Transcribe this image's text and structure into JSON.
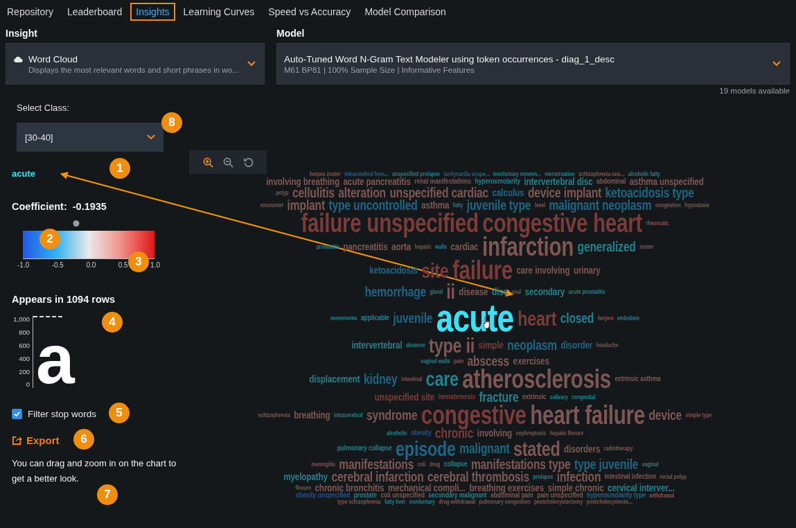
{
  "tabs": [
    {
      "label": "Repository",
      "selected": false
    },
    {
      "label": "Leaderboard",
      "selected": false
    },
    {
      "label": "Insights",
      "selected": true
    },
    {
      "label": "Learning Curves",
      "selected": false
    },
    {
      "label": "Speed vs Accuracy",
      "selected": false
    },
    {
      "label": "Model Comparison",
      "selected": false
    }
  ],
  "insight": {
    "label": "Insight",
    "title": "Word Cloud",
    "description": "Displays the most relevant words and short phrases in wo..."
  },
  "model": {
    "label": "Model",
    "title": "Auto-Tuned Word N-Gram Text Modeler using token occurrences - diag_1_desc",
    "description": "M61 BP81 | 100% Sample Size | Informative Features",
    "count": "19 models available"
  },
  "class_select": {
    "label": "Select Class:",
    "value": "[30-40]"
  },
  "word_detail": {
    "word": "acute",
    "coefficient_label": "Coefficient:",
    "coefficient": "-0.1935",
    "level": 0.403,
    "scale_ticks": [
      "-1.0",
      "-0.5",
      "0.0",
      "0.5",
      "1.0"
    ],
    "appears": "Appears in 1094 rows",
    "axis_ticks": [
      "1,000",
      "800",
      "600",
      "400",
      "200",
      "0"
    ],
    "glyph": "a"
  },
  "filter_stop_words": {
    "label": "Filter stop words",
    "checked": true
  },
  "export": {
    "label": "Export"
  },
  "hint": "You can drag and zoom in on the chart to get a better look.",
  "callouts": [
    "1",
    "2",
    "3",
    "4",
    "5",
    "6",
    "7",
    "8"
  ],
  "word_cloud": {
    "rows": [
      {
        "words": [
          {
            "text": "herpes zoster",
            "kind": "tiny",
            "color": "#7e5754",
            "selected": false
          },
          {
            "text": "intracerebral hem...",
            "kind": "tiny",
            "color": "#1e6585",
            "selected": false
          },
          {
            "text": "unspecified prolapse",
            "kind": "tiny",
            "color": "#24808c",
            "selected": false
          },
          {
            "text": "tachycardia unspe...",
            "kind": "tiny",
            "color": "#1e6585",
            "selected": false
          },
          {
            "text": "involuntary movem...",
            "kind": "tiny",
            "color": "#24808c",
            "selected": false
          },
          {
            "text": "menstruation",
            "kind": "tiny",
            "color": "#24808c",
            "selected": false
          },
          {
            "text": "schizophrenia uns...",
            "kind": "tiny",
            "color": "#7e5754",
            "selected": false
          },
          {
            "text": "alcoholic fatty",
            "kind": "tiny",
            "color": "#24808c",
            "selected": false
          }
        ]
      },
      {
        "words": [
          {
            "text": "involving breathing",
            "kind": "medium",
            "color": "#7e5754",
            "selected": false
          },
          {
            "text": "acute pancreatitis",
            "kind": "medium",
            "color": "#7e5754",
            "selected": false
          },
          {
            "text": "renal manifestations",
            "kind": "small",
            "color": "#7e5754",
            "selected": false
          },
          {
            "text": "hyperosmolarity",
            "kind": "small",
            "color": "#24808c",
            "selected": false
          },
          {
            "text": "intervertebral disc",
            "kind": "medium",
            "color": "#24808c",
            "selected": false
          },
          {
            "text": "abdominal",
            "kind": "small",
            "color": "#7e5754",
            "selected": false
          },
          {
            "text": "asthma unspecified",
            "kind": "medium",
            "color": "#7e5754",
            "selected": false
          }
        ]
      },
      {
        "words": [
          {
            "text": "polyp",
            "kind": "tiny",
            "color": "#7e5754",
            "selected": false
          },
          {
            "text": "cellulitis",
            "kind": "large",
            "color": "#7e5754",
            "selected": false
          },
          {
            "text": "alteration",
            "kind": "large",
            "color": "#7e5754",
            "selected": false
          },
          {
            "text": "unspecified cardiac",
            "kind": "large",
            "color": "#7e5754",
            "selected": false
          },
          {
            "text": "calculus",
            "kind": "medium",
            "color": "#1e6585",
            "selected": false
          },
          {
            "text": "device implant",
            "kind": "large",
            "color": "#7e5754",
            "selected": false
          },
          {
            "text": "ketoacidosis type",
            "kind": "large",
            "color": "#1e6585",
            "selected": false
          }
        ]
      },
      {
        "words": [
          {
            "text": "encounter",
            "kind": "tiny",
            "color": "#7e5754",
            "selected": false
          },
          {
            "text": "implant",
            "kind": "large",
            "color": "#7e5754",
            "selected": false
          },
          {
            "text": "type uncontrolled",
            "kind": "large",
            "color": "#1e6585",
            "selected": false
          },
          {
            "text": "asthma",
            "kind": "medium",
            "color": "#7e5754",
            "selected": false
          },
          {
            "text": "fatty",
            "kind": "tiny",
            "color": "#24808c",
            "selected": false
          },
          {
            "text": "juvenile type",
            "kind": "large",
            "color": "#1e6585",
            "selected": false
          },
          {
            "text": "level",
            "kind": "tiny",
            "color": "#7e5754",
            "selected": false
          },
          {
            "text": "malignant neoplasm",
            "kind": "large",
            "color": "#1e6585",
            "selected": false
          },
          {
            "text": "congestion",
            "kind": "tiny",
            "color": "#7e5754",
            "selected": false
          },
          {
            "text": "hypostasis",
            "kind": "tiny",
            "color": "#7e5754",
            "selected": false
          }
        ]
      },
      {
        "words": [
          {
            "text": "failure unspecified",
            "kind": "giant",
            "color": "#7a3b39",
            "selected": false
          },
          {
            "text": "congestive heart",
            "kind": "giant",
            "color": "#7a3b39",
            "selected": false
          },
          {
            "text": "rheumatic",
            "kind": "tiny",
            "color": "#7e5754",
            "selected": false
          }
        ]
      },
      {
        "words": [
          {
            "text": "prostatitis",
            "kind": "tiny",
            "color": "#24808c",
            "selected": false
          },
          {
            "text": "pancreatitis",
            "kind": "medium",
            "color": "#7e5754",
            "selected": false
          },
          {
            "text": "aorta",
            "kind": "medium",
            "color": "#7e5754",
            "selected": false
          },
          {
            "text": "hepatic",
            "kind": "tiny",
            "color": "#7e5754",
            "selected": false
          },
          {
            "text": "walls",
            "kind": "tiny",
            "color": "#24808c",
            "selected": false
          },
          {
            "text": "cardiac",
            "kind": "medium",
            "color": "#7e5754",
            "selected": false
          },
          {
            "text": "infarction",
            "kind": "giant",
            "color": "#7e5754",
            "selected": false
          },
          {
            "text": "generalized",
            "kind": "large",
            "color": "#24808c",
            "selected": false
          },
          {
            "text": "zoster",
            "kind": "tiny",
            "color": "#7e5754",
            "selected": false
          }
        ]
      },
      {
        "words": [
          {
            "text": "ketoacidosis",
            "kind": "medium",
            "color": "#1e6585",
            "selected": false
          },
          {
            "text": "site",
            "kind": "big",
            "color": "#7a3b39",
            "selected": false
          },
          {
            "text": "failure",
            "kind": "giant",
            "color": "#7a3b39",
            "selected": false
          },
          {
            "text": "care involving",
            "kind": "medium",
            "color": "#7e5754",
            "selected": false
          },
          {
            "text": "urinary",
            "kind": "medium",
            "color": "#7e5754",
            "selected": false
          }
        ]
      },
      {
        "words": [
          {
            "text": "hemorrhage",
            "kind": "large",
            "color": "#1e6585",
            "selected": false
          },
          {
            "text": "gland",
            "kind": "tiny",
            "color": "#24808c",
            "selected": false
          },
          {
            "text": "ii",
            "kind": "big",
            "color": "#7e5754",
            "selected": false
          },
          {
            "text": "disease",
            "kind": "medium",
            "color": "#7e5754",
            "selected": false
          },
          {
            "text": "disc",
            "kind": "medium",
            "color": "#24808c",
            "selected": false
          },
          {
            "text": "anal",
            "kind": "tiny",
            "color": "#7e5754",
            "selected": false
          },
          {
            "text": "secondary",
            "kind": "medium",
            "color": "#24808c",
            "selected": false
          },
          {
            "text": "acute prostatitis",
            "kind": "tiny",
            "color": "#24808c",
            "selected": false
          }
        ]
      },
      {
        "words": [
          {
            "text": "movements",
            "kind": "tiny",
            "color": "#24808c",
            "selected": false
          },
          {
            "text": "applicable",
            "kind": "small",
            "color": "#24808c",
            "selected": false
          },
          {
            "text": "juvenile",
            "kind": "large",
            "color": "#1e6585",
            "selected": false
          },
          {
            "text": "acute",
            "kind": "huge",
            "color": "#3de0f6",
            "selected": true
          },
          {
            "text": "heart",
            "kind": "big",
            "color": "#7a3b39",
            "selected": false
          },
          {
            "text": "closed",
            "kind": "large",
            "color": "#24808c",
            "selected": false
          },
          {
            "text": "herpes",
            "kind": "tiny",
            "color": "#7e5754",
            "selected": false
          },
          {
            "text": "embolism",
            "kind": "tiny",
            "color": "#24808c",
            "selected": false
          }
        ]
      },
      {
        "words": [
          {
            "text": "intervertebral",
            "kind": "medium",
            "color": "#24808c",
            "selected": false
          },
          {
            "text": "absence",
            "kind": "tiny",
            "color": "#24808c",
            "selected": false
          },
          {
            "text": "type ii",
            "kind": "big",
            "color": "#7e5754",
            "selected": false
          },
          {
            "text": "simple",
            "kind": "medium",
            "color": "#7a3b39",
            "selected": false
          },
          {
            "text": "neoplasm",
            "kind": "large",
            "color": "#1e6585",
            "selected": false
          },
          {
            "text": "disorder",
            "kind": "medium",
            "color": "#1e6585",
            "selected": false
          },
          {
            "text": "headache",
            "kind": "tiny",
            "color": "#7e5754",
            "selected": false
          }
        ]
      },
      {
        "words": [
          {
            "text": "vaginal walls",
            "kind": "tiny",
            "color": "#24808c",
            "selected": false
          },
          {
            "text": "pain",
            "kind": "tiny",
            "color": "#7e5754",
            "selected": false
          },
          {
            "text": "abscess",
            "kind": "large",
            "color": "#7e5754",
            "selected": false
          },
          {
            "text": "exercises",
            "kind": "medium",
            "color": "#7e5754",
            "selected": false
          }
        ]
      },
      {
        "words": [
          {
            "text": "displacement",
            "kind": "medium",
            "color": "#24808c",
            "selected": false
          },
          {
            "text": "kidney",
            "kind": "large",
            "color": "#1e6585",
            "selected": false
          },
          {
            "text": "intestinal",
            "kind": "tiny",
            "color": "#7e5754",
            "selected": false
          },
          {
            "text": "care",
            "kind": "big",
            "color": "#24808c",
            "selected": false
          },
          {
            "text": "atherosclerosis",
            "kind": "giant",
            "color": "#7e5754",
            "selected": false
          },
          {
            "text": "extrinsic asthma",
            "kind": "small",
            "color": "#7e5754",
            "selected": false
          }
        ]
      },
      {
        "words": [
          {
            "text": "unspecified site",
            "kind": "medium",
            "color": "#7a3b39",
            "selected": false
          },
          {
            "text": "hematemesis",
            "kind": "small",
            "color": "#7a3b39",
            "selected": false
          },
          {
            "text": "fracture",
            "kind": "large",
            "color": "#24808c",
            "selected": false
          },
          {
            "text": "extrinsic",
            "kind": "small",
            "color": "#7e5754",
            "selected": false
          },
          {
            "text": "salivary",
            "kind": "tiny",
            "color": "#24808c",
            "selected": false
          },
          {
            "text": "congenital",
            "kind": "tiny",
            "color": "#24808c",
            "selected": false
          }
        ]
      },
      {
        "words": [
          {
            "text": "schizophrenia",
            "kind": "tiny",
            "color": "#7e5754",
            "selected": false
          },
          {
            "text": "breathing",
            "kind": "medium",
            "color": "#7e5754",
            "selected": false
          },
          {
            "text": "intracerebral",
            "kind": "tiny",
            "color": "#24808c",
            "selected": false
          },
          {
            "text": "syndrome",
            "kind": "large",
            "color": "#7e5754",
            "selected": false
          },
          {
            "text": "congestive",
            "kind": "giant",
            "color": "#7a3b39",
            "selected": false
          },
          {
            "text": "heart failure",
            "kind": "giant",
            "color": "#7e5754",
            "selected": false
          },
          {
            "text": "device",
            "kind": "large",
            "color": "#7e5754",
            "selected": false
          },
          {
            "text": "simple type",
            "kind": "tiny",
            "color": "#7e5754",
            "selected": false
          }
        ]
      },
      {
        "words": [
          {
            "text": "alcoholic",
            "kind": "tiny",
            "color": "#24808c",
            "selected": false
          },
          {
            "text": "obesity",
            "kind": "small",
            "color": "#284f92",
            "selected": false
          },
          {
            "text": "chronic",
            "kind": "large",
            "color": "#7a3b39",
            "selected": false
          },
          {
            "text": "involving",
            "kind": "medium",
            "color": "#7e5754",
            "selected": false
          },
          {
            "text": "nephroptosis",
            "kind": "tiny",
            "color": "#7e5754",
            "selected": false
          },
          {
            "text": "hepatic flexure",
            "kind": "tiny",
            "color": "#7e5754",
            "selected": false
          }
        ]
      },
      {
        "words": [
          {
            "text": "pulmonary collapse",
            "kind": "small",
            "color": "#24808c",
            "selected": false
          },
          {
            "text": "episode",
            "kind": "big",
            "color": "#1e6585",
            "selected": false
          },
          {
            "text": "malignant",
            "kind": "large",
            "color": "#1e6585",
            "selected": false
          },
          {
            "text": "stated",
            "kind": "big",
            "color": "#7e5754",
            "selected": false
          },
          {
            "text": "disorders",
            "kind": "medium",
            "color": "#7e5754",
            "selected": false
          },
          {
            "text": "radiotherapy",
            "kind": "tiny",
            "color": "#7e5754",
            "selected": false
          }
        ]
      },
      {
        "words": [
          {
            "text": "meningitis",
            "kind": "tiny",
            "color": "#7e5754",
            "selected": false
          },
          {
            "text": "manifestations",
            "kind": "large",
            "color": "#7e5754",
            "selected": false
          },
          {
            "text": "coli",
            "kind": "tiny",
            "color": "#7e5754",
            "selected": false
          },
          {
            "text": "drug",
            "kind": "tiny",
            "color": "#7e5754",
            "selected": false
          },
          {
            "text": "collapse",
            "kind": "small",
            "color": "#24808c",
            "selected": false
          },
          {
            "text": "manifestations type",
            "kind": "large",
            "color": "#7e5754",
            "selected": false
          },
          {
            "text": "type juvenile",
            "kind": "large",
            "color": "#1e6585",
            "selected": false
          },
          {
            "text": "vaginal",
            "kind": "tiny",
            "color": "#24808c",
            "selected": false
          }
        ]
      },
      {
        "words": [
          {
            "text": "myelopathy",
            "kind": "medium",
            "color": "#24808c",
            "selected": false
          },
          {
            "text": "cerebral infarction",
            "kind": "large",
            "color": "#7e5754",
            "selected": false
          },
          {
            "text": "cerebral thrombosis",
            "kind": "large",
            "color": "#7e5754",
            "selected": false
          },
          {
            "text": "prolapse",
            "kind": "tiny",
            "color": "#24808c",
            "selected": false
          },
          {
            "text": "infection",
            "kind": "large",
            "color": "#7e5754",
            "selected": false
          },
          {
            "text": "intestinal infection",
            "kind": "small",
            "color": "#7e5754",
            "selected": false
          },
          {
            "text": "rectal polyp",
            "kind": "tiny",
            "color": "#7e5754",
            "selected": false
          }
        ]
      },
      {
        "words": [
          {
            "text": "flexure",
            "kind": "tiny",
            "color": "#7e5754",
            "selected": false
          },
          {
            "text": "chronic bronchitis",
            "kind": "medium",
            "color": "#7e5754",
            "selected": false
          },
          {
            "text": "mechanical compli...",
            "kind": "medium",
            "color": "#7e5754",
            "selected": false
          },
          {
            "text": "breathing exercises",
            "kind": "medium",
            "color": "#7e5754",
            "selected": false
          },
          {
            "text": "simple chronic",
            "kind": "medium",
            "color": "#7e5754",
            "selected": false
          },
          {
            "text": "cervical interver...",
            "kind": "medium",
            "color": "#24808c",
            "selected": false
          }
        ]
      },
      {
        "words": [
          {
            "text": "obesity unspecified",
            "kind": "small",
            "color": "#284f92",
            "selected": false
          },
          {
            "text": "prostate",
            "kind": "small",
            "color": "#24808c",
            "selected": false
          },
          {
            "text": "coli unspecified",
            "kind": "small",
            "color": "#7e5754",
            "selected": false
          },
          {
            "text": "secondary malignant",
            "kind": "small",
            "color": "#24808c",
            "selected": false
          },
          {
            "text": "abdominal pain",
            "kind": "small",
            "color": "#7e5754",
            "selected": false
          },
          {
            "text": "pain unspecified",
            "kind": "small",
            "color": "#7e5754",
            "selected": false
          },
          {
            "text": "hyperosmolarity type",
            "kind": "small",
            "color": "#1e6585",
            "selected": false
          },
          {
            "text": "withdrawal",
            "kind": "tiny",
            "color": "#7e5754",
            "selected": false
          }
        ]
      },
      {
        "words": [
          {
            "text": "type schizophrenia",
            "kind": "tiny",
            "color": "#7e5754",
            "selected": false
          },
          {
            "text": "fatty liver",
            "kind": "tiny",
            "color": "#24808c",
            "selected": false
          },
          {
            "text": "involuntary",
            "kind": "tiny",
            "color": "#24808c",
            "selected": false
          },
          {
            "text": "drug withdrawal",
            "kind": "tiny",
            "color": "#7e5754",
            "selected": false
          },
          {
            "text": "pulmonary congestion",
            "kind": "tiny",
            "color": "#7e5754",
            "selected": false
          },
          {
            "text": "postcholecystectomy",
            "kind": "tiny",
            "color": "#7e5754",
            "selected": false
          },
          {
            "text": "postcholecystecto...",
            "kind": "tiny",
            "color": "#7e5754",
            "selected": false
          }
        ]
      }
    ]
  }
}
